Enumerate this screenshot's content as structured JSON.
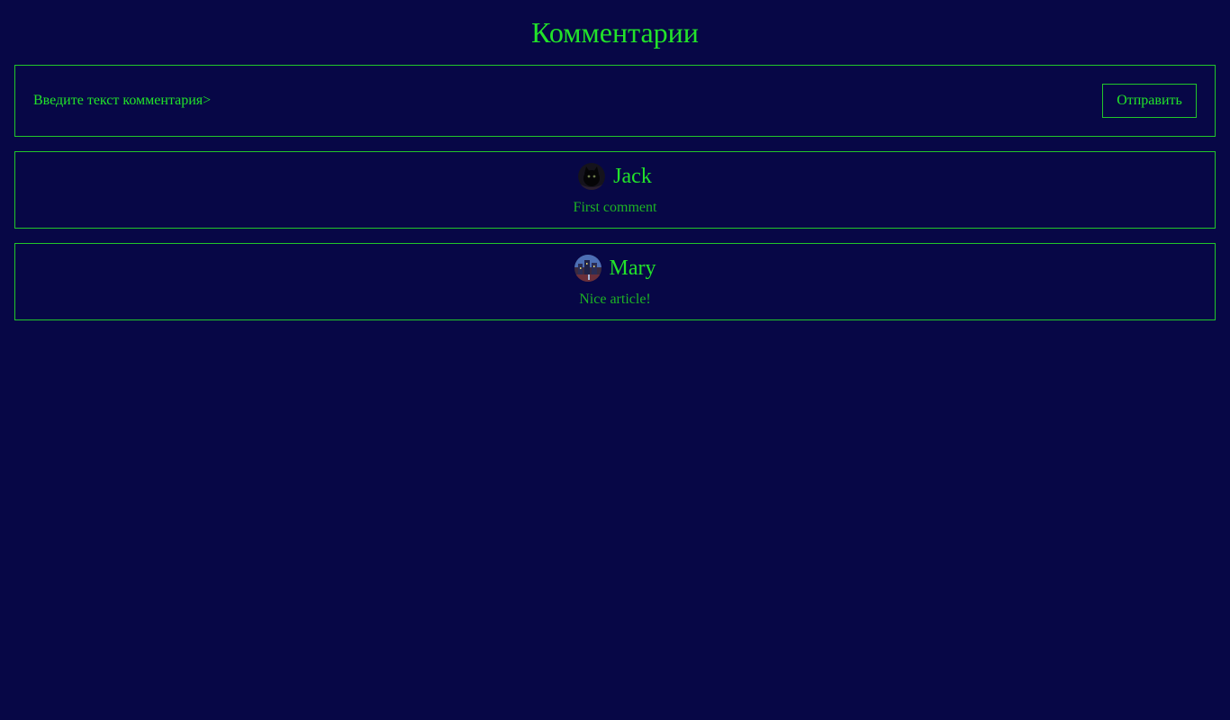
{
  "header": {
    "title": "Комментарии"
  },
  "compose": {
    "placeholder": "Введите текст комментария>",
    "value": "",
    "send_label": "Отправить"
  },
  "comments": [
    {
      "author": "Jack",
      "text": "First comment",
      "avatar_icon": "black-cat-avatar"
    },
    {
      "author": "Mary",
      "text": "Nice article!",
      "avatar_icon": "night-city-avatar"
    }
  ],
  "colors": {
    "background": "#070746",
    "accent": "#22e32a",
    "border": "#22c62a",
    "comment_text": "#1db324"
  }
}
